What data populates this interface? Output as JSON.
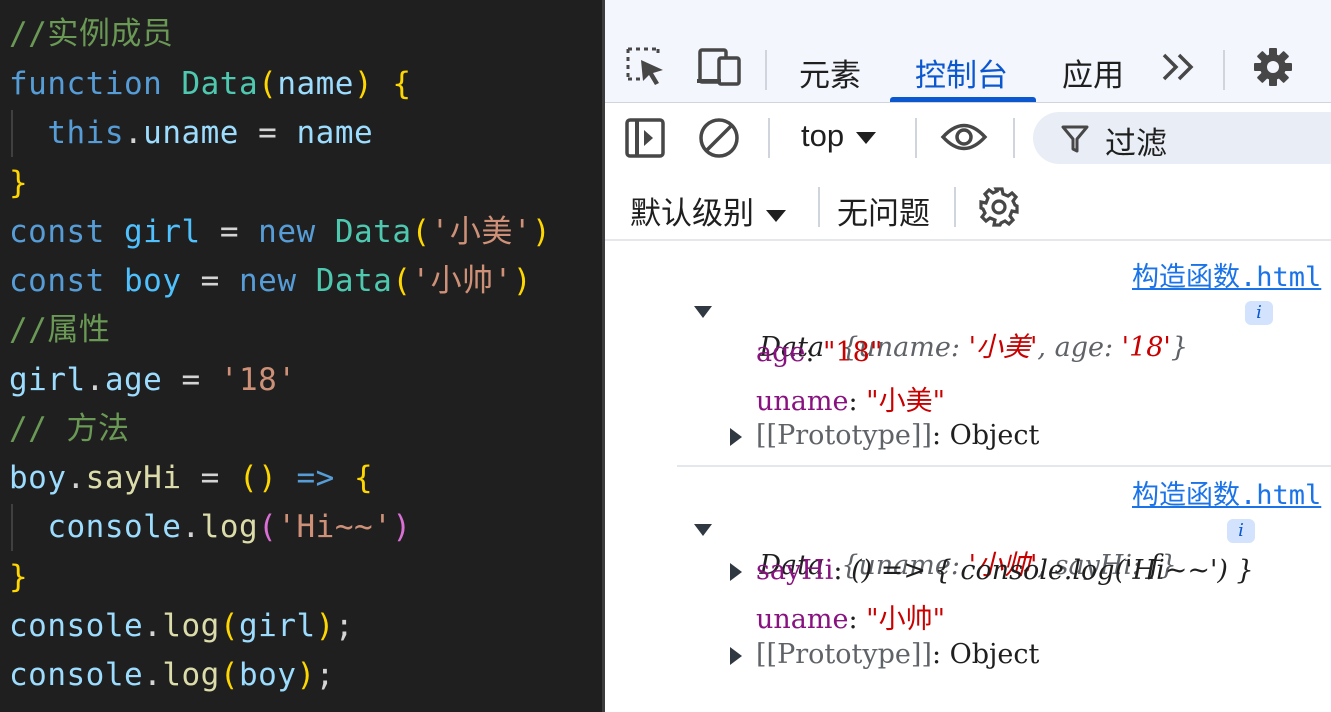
{
  "editor": {
    "comment1": "//实例成员",
    "kw_function": "function",
    "cls_Data": "Data",
    "paren_open": "(",
    "param_name": "name",
    "paren_close": ")",
    "brace_open": "{",
    "kw_this": "this",
    "dot": ".",
    "prop_uname": "uname",
    "eq": "=",
    "brace_close": "}",
    "kw_const": "const",
    "var_girl": "girl",
    "kw_new": "new",
    "str_xiaomei": "'小美'",
    "var_boy": "boy",
    "str_xiaoshuai": "'小帅'",
    "comment2": "//属性",
    "prop_age": "age",
    "str_18": "'18'",
    "comment3": "// 方法",
    "prop_sayHi": "sayHi",
    "arrow_parens": "()",
    "arrow": "=>",
    "console": "console",
    "fn_log": "log",
    "str_hi": "'Hi~~'",
    "semicolon": ";"
  },
  "devtools": {
    "tabs": [
      "元素",
      "控制台",
      "应用"
    ],
    "active_tab": "控制台",
    "more_tabs": "»",
    "context": "top",
    "filter_label": "过滤",
    "levels": "默认级别",
    "issues": "无问题",
    "messages": [
      {
        "source": "构造函数.html",
        "summary_class": "Data",
        "summary_open": "{",
        "summary_key1": "uname",
        "summary_val1": "'小美'",
        "summary_key2": "age",
        "summary_val2": "'18'",
        "summary_close": "}",
        "info": "i",
        "props": [
          {
            "key": "age",
            "value": "\"18\""
          },
          {
            "key": "uname",
            "value": "\"小美\""
          }
        ],
        "proto_key": "[[Prototype]]",
        "proto_val": "Object"
      },
      {
        "source": "构造函数.html",
        "summary_class": "Data",
        "summary_open": "{",
        "summary_key1": "uname",
        "summary_val1": "'小帅'",
        "summary_key2": "sayHi",
        "summary_val2": "f",
        "summary_close": "}",
        "info": "i",
        "method_key": "sayHi",
        "method_val": "() => { console.log('Hi~~') }",
        "props": [
          {
            "key": "uname",
            "value": "\"小帅\""
          }
        ],
        "proto_key": "[[Prototype]]",
        "proto_val": "Object"
      }
    ]
  }
}
